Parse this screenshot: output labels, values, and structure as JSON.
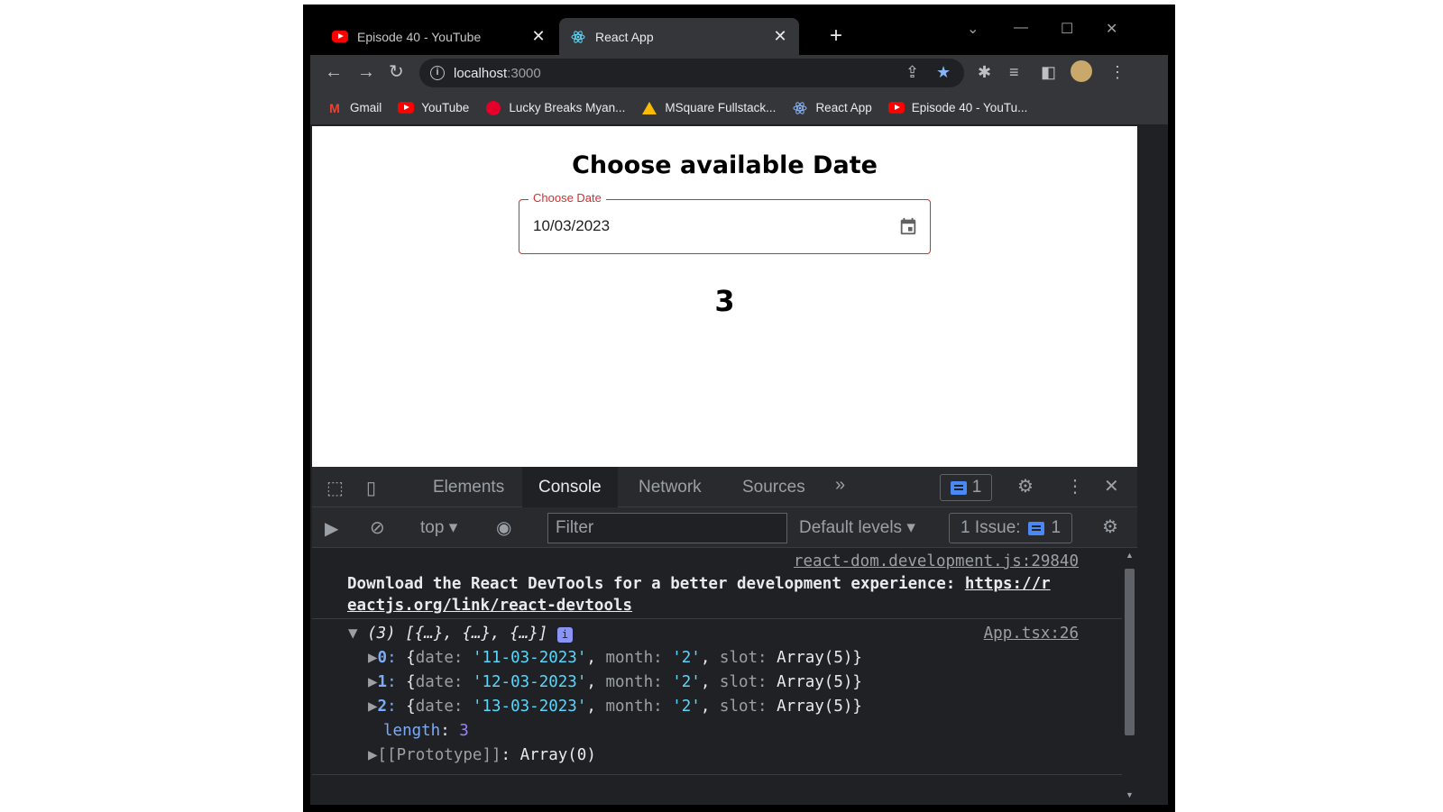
{
  "browser": {
    "tabs": [
      {
        "title": "Episode 40 - YouTube",
        "icon": "youtube-icon",
        "active": false
      },
      {
        "title": "React App",
        "icon": "react-icon",
        "active": true
      }
    ],
    "new_tab": "+",
    "address": {
      "host": "localhost",
      "port": ":3000"
    },
    "bookmarks": [
      {
        "label": "Gmail",
        "icon": "gmail-icon"
      },
      {
        "label": "YouTube",
        "icon": "youtube-icon"
      },
      {
        "label": "Lucky Breaks Myan...",
        "icon": "coca-cola-icon"
      },
      {
        "label": "MSquare Fullstack...",
        "icon": "google-drive-icon"
      },
      {
        "label": "React App",
        "icon": "react-icon"
      },
      {
        "label": "Episode 40 - YouTu...",
        "icon": "youtube-icon"
      }
    ]
  },
  "page": {
    "title": "Choose available Date",
    "date_field": {
      "label": "Choose Date",
      "value": "10/03/2023"
    },
    "count": "3",
    "accent_color": "#d32f2f"
  },
  "devtools": {
    "tabs": [
      "Elements",
      "Console",
      "Network",
      "Sources"
    ],
    "more": "»",
    "active_tab": "Console",
    "issues_count": "1",
    "context": "top",
    "filter_placeholder": "Filter",
    "levels": "Default levels",
    "issue_label": "1 Issue:",
    "issue_count": "1",
    "console": {
      "msg1_source": "react-dom.development.js:29840",
      "msg1_text": "Download the React DevTools for a better development experience: ",
      "msg1_link_a": "https://r",
      "msg1_link_b": "eactjs.org/link/react-devtools",
      "msg2_source": "App.tsx:26",
      "array_summary": "(3) [{…}, {…}, {…}]",
      "items": [
        {
          "index": "0",
          "date": "'11-03-2023'",
          "month": "'2'",
          "slot": "Array(5)"
        },
        {
          "index": "1",
          "date": "'12-03-2023'",
          "month": "'2'",
          "slot": "Array(5)"
        },
        {
          "index": "2",
          "date": "'13-03-2023'",
          "month": "'2'",
          "slot": "Array(5)"
        }
      ],
      "length_key": "length",
      "length_value": "3",
      "prototype": "[[Prototype]]",
      "prototype_value": "Array(0)"
    }
  }
}
